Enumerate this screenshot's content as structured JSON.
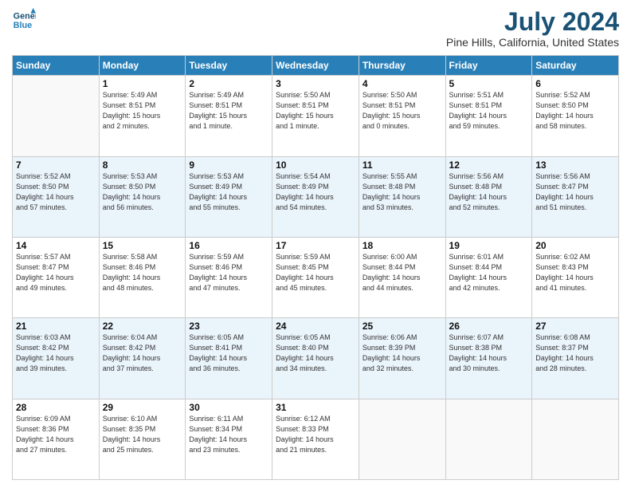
{
  "header": {
    "logo_line1": "General",
    "logo_line2": "Blue",
    "month": "July 2024",
    "location": "Pine Hills, California, United States"
  },
  "days_of_week": [
    "Sunday",
    "Monday",
    "Tuesday",
    "Wednesday",
    "Thursday",
    "Friday",
    "Saturday"
  ],
  "weeks": [
    [
      {
        "day": "",
        "info": ""
      },
      {
        "day": "1",
        "info": "Sunrise: 5:49 AM\nSunset: 8:51 PM\nDaylight: 15 hours\nand 2 minutes."
      },
      {
        "day": "2",
        "info": "Sunrise: 5:49 AM\nSunset: 8:51 PM\nDaylight: 15 hours\nand 1 minute."
      },
      {
        "day": "3",
        "info": "Sunrise: 5:50 AM\nSunset: 8:51 PM\nDaylight: 15 hours\nand 1 minute."
      },
      {
        "day": "4",
        "info": "Sunrise: 5:50 AM\nSunset: 8:51 PM\nDaylight: 15 hours\nand 0 minutes."
      },
      {
        "day": "5",
        "info": "Sunrise: 5:51 AM\nSunset: 8:51 PM\nDaylight: 14 hours\nand 59 minutes."
      },
      {
        "day": "6",
        "info": "Sunrise: 5:52 AM\nSunset: 8:50 PM\nDaylight: 14 hours\nand 58 minutes."
      }
    ],
    [
      {
        "day": "7",
        "info": "Sunrise: 5:52 AM\nSunset: 8:50 PM\nDaylight: 14 hours\nand 57 minutes."
      },
      {
        "day": "8",
        "info": "Sunrise: 5:53 AM\nSunset: 8:50 PM\nDaylight: 14 hours\nand 56 minutes."
      },
      {
        "day": "9",
        "info": "Sunrise: 5:53 AM\nSunset: 8:49 PM\nDaylight: 14 hours\nand 55 minutes."
      },
      {
        "day": "10",
        "info": "Sunrise: 5:54 AM\nSunset: 8:49 PM\nDaylight: 14 hours\nand 54 minutes."
      },
      {
        "day": "11",
        "info": "Sunrise: 5:55 AM\nSunset: 8:48 PM\nDaylight: 14 hours\nand 53 minutes."
      },
      {
        "day": "12",
        "info": "Sunrise: 5:56 AM\nSunset: 8:48 PM\nDaylight: 14 hours\nand 52 minutes."
      },
      {
        "day": "13",
        "info": "Sunrise: 5:56 AM\nSunset: 8:47 PM\nDaylight: 14 hours\nand 51 minutes."
      }
    ],
    [
      {
        "day": "14",
        "info": "Sunrise: 5:57 AM\nSunset: 8:47 PM\nDaylight: 14 hours\nand 49 minutes."
      },
      {
        "day": "15",
        "info": "Sunrise: 5:58 AM\nSunset: 8:46 PM\nDaylight: 14 hours\nand 48 minutes."
      },
      {
        "day": "16",
        "info": "Sunrise: 5:59 AM\nSunset: 8:46 PM\nDaylight: 14 hours\nand 47 minutes."
      },
      {
        "day": "17",
        "info": "Sunrise: 5:59 AM\nSunset: 8:45 PM\nDaylight: 14 hours\nand 45 minutes."
      },
      {
        "day": "18",
        "info": "Sunrise: 6:00 AM\nSunset: 8:44 PM\nDaylight: 14 hours\nand 44 minutes."
      },
      {
        "day": "19",
        "info": "Sunrise: 6:01 AM\nSunset: 8:44 PM\nDaylight: 14 hours\nand 42 minutes."
      },
      {
        "day": "20",
        "info": "Sunrise: 6:02 AM\nSunset: 8:43 PM\nDaylight: 14 hours\nand 41 minutes."
      }
    ],
    [
      {
        "day": "21",
        "info": "Sunrise: 6:03 AM\nSunset: 8:42 PM\nDaylight: 14 hours\nand 39 minutes."
      },
      {
        "day": "22",
        "info": "Sunrise: 6:04 AM\nSunset: 8:42 PM\nDaylight: 14 hours\nand 37 minutes."
      },
      {
        "day": "23",
        "info": "Sunrise: 6:05 AM\nSunset: 8:41 PM\nDaylight: 14 hours\nand 36 minutes."
      },
      {
        "day": "24",
        "info": "Sunrise: 6:05 AM\nSunset: 8:40 PM\nDaylight: 14 hours\nand 34 minutes."
      },
      {
        "day": "25",
        "info": "Sunrise: 6:06 AM\nSunset: 8:39 PM\nDaylight: 14 hours\nand 32 minutes."
      },
      {
        "day": "26",
        "info": "Sunrise: 6:07 AM\nSunset: 8:38 PM\nDaylight: 14 hours\nand 30 minutes."
      },
      {
        "day": "27",
        "info": "Sunrise: 6:08 AM\nSunset: 8:37 PM\nDaylight: 14 hours\nand 28 minutes."
      }
    ],
    [
      {
        "day": "28",
        "info": "Sunrise: 6:09 AM\nSunset: 8:36 PM\nDaylight: 14 hours\nand 27 minutes."
      },
      {
        "day": "29",
        "info": "Sunrise: 6:10 AM\nSunset: 8:35 PM\nDaylight: 14 hours\nand 25 minutes."
      },
      {
        "day": "30",
        "info": "Sunrise: 6:11 AM\nSunset: 8:34 PM\nDaylight: 14 hours\nand 23 minutes."
      },
      {
        "day": "31",
        "info": "Sunrise: 6:12 AM\nSunset: 8:33 PM\nDaylight: 14 hours\nand 21 minutes."
      },
      {
        "day": "",
        "info": ""
      },
      {
        "day": "",
        "info": ""
      },
      {
        "day": "",
        "info": ""
      }
    ]
  ]
}
